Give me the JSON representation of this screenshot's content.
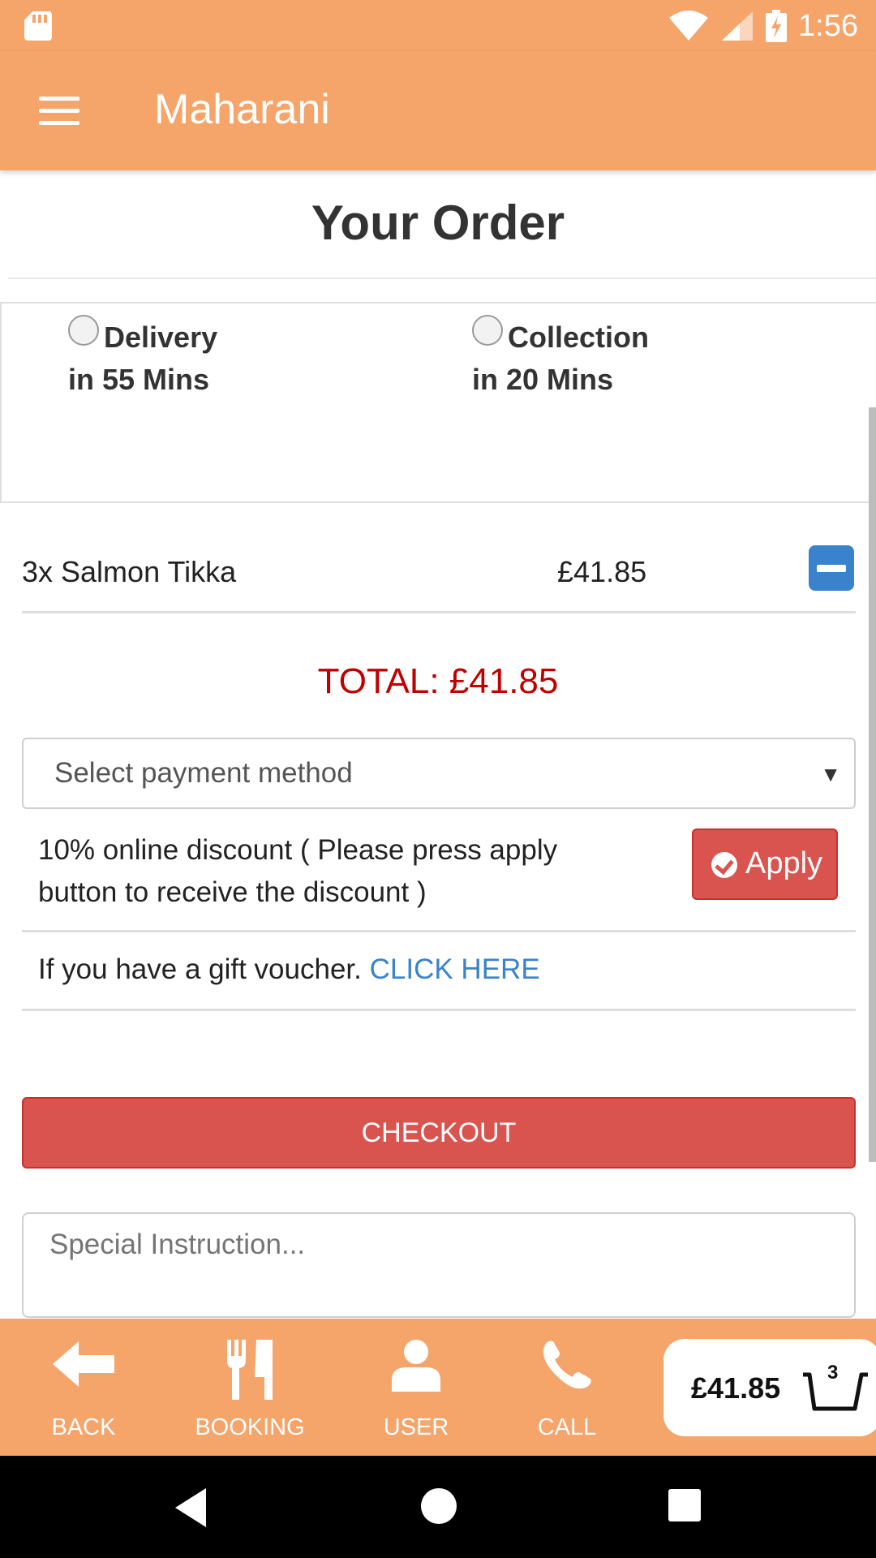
{
  "status_bar": {
    "time": "1:56"
  },
  "app_bar": {
    "title": "Maharani"
  },
  "page": {
    "title": "Your Order"
  },
  "order_options": [
    {
      "label": "Delivery",
      "time": "in 55 Mins"
    },
    {
      "label": "Collection",
      "time": "in 20 Mins"
    }
  ],
  "order_items": [
    {
      "name": "3x Salmon Tikka",
      "price": "£41.85"
    }
  ],
  "total": "TOTAL: £41.85",
  "payment": {
    "placeholder": "Select payment method"
  },
  "discount": {
    "text": "10% online discount ( Please press apply button to receive the discount )",
    "apply_label": "Apply"
  },
  "voucher": {
    "text": "If you have a gift voucher.",
    "link": "CLICK HERE"
  },
  "checkout_label": "CHECKOUT",
  "special_instruction": {
    "placeholder": "Special Instruction..."
  },
  "bottom_nav": [
    {
      "label": "BACK",
      "icon": "arrow-left-icon"
    },
    {
      "label": "BOOKING",
      "icon": "fork-knife-icon"
    },
    {
      "label": "USER",
      "icon": "user-icon"
    },
    {
      "label": "CALL",
      "icon": "phone-icon"
    }
  ],
  "cart": {
    "total": "£41.85",
    "count": "3",
    "icon": "basket-icon"
  },
  "colors": {
    "brand": "#f5a46a",
    "danger": "#d9534f",
    "link": "#3a82cc",
    "total": "#c00000"
  }
}
